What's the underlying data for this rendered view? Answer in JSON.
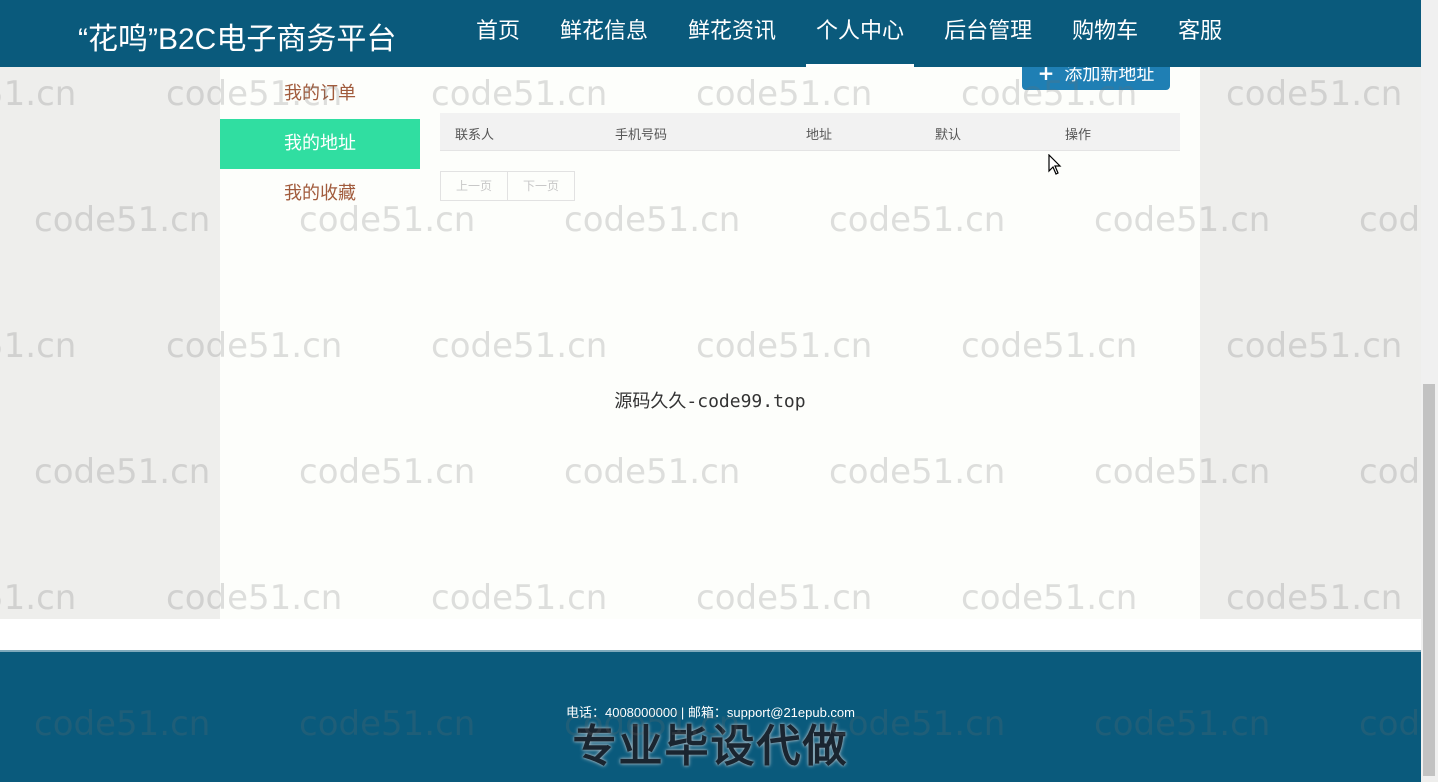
{
  "header": {
    "title": "“花鸣”B2C电子商务平台",
    "nav": [
      {
        "label": "首页"
      },
      {
        "label": "鲜花信息"
      },
      {
        "label": "鲜花资讯"
      },
      {
        "label": "个人中心",
        "active": true
      },
      {
        "label": "后台管理"
      },
      {
        "label": "购物车"
      },
      {
        "label": "客服"
      }
    ]
  },
  "sidebar": {
    "items": [
      {
        "label": "我的订单"
      },
      {
        "label": "我的地址",
        "active": true
      },
      {
        "label": "我的收藏"
      }
    ]
  },
  "main": {
    "add_button": {
      "icon": "plus-icon",
      "label": "添加新地址"
    },
    "table": {
      "columns": [
        "联系人",
        "手机号码",
        "地址",
        "默认",
        "操作"
      ],
      "rows": []
    },
    "pager": {
      "prev": "上一页",
      "next": "下一页"
    },
    "center_text": "源码久久-code99.top"
  },
  "footer": {
    "contact": "电话：4008000000 | 邮箱：support@21epub.com",
    "overlay": "专业毕设代做"
  },
  "watermark": {
    "text": "code51.cn"
  },
  "colors": {
    "header": "#0a5a7c",
    "sidebar_active": "#30dea1",
    "add_button": "#1f7fb4",
    "sidebar_text": "#a15b3c"
  }
}
